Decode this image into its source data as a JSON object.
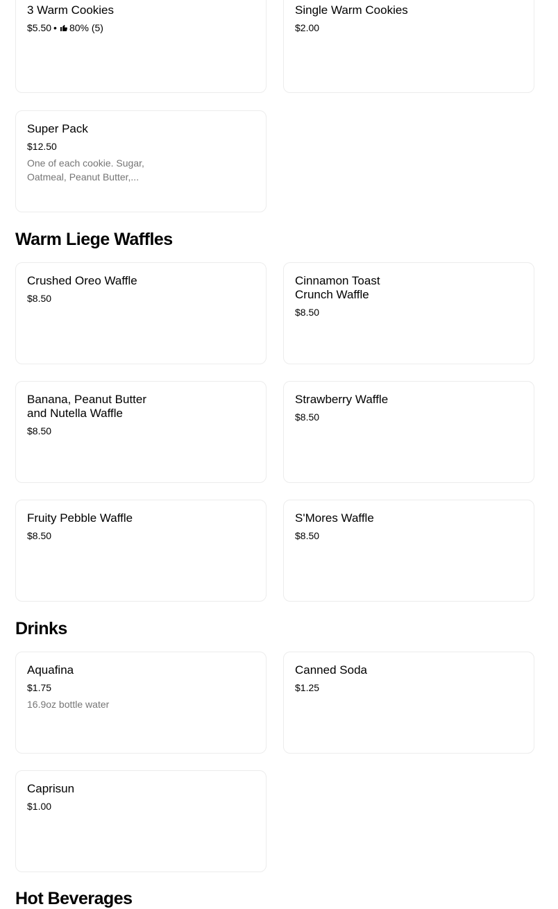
{
  "sections": [
    {
      "title": "",
      "items": [
        {
          "name": "3 Warm Cookies",
          "price": "$5.50",
          "rating": "80% (5)"
        },
        {
          "name": "Single Warm Cookies",
          "price": "$2.00"
        },
        {
          "name": "Super Pack",
          "price": "$12.50",
          "description": "One of each cookie. Sugar, Oatmeal, Peanut Butter,..."
        }
      ]
    },
    {
      "title": "Warm Liege Waffles",
      "items": [
        {
          "name": "Crushed Oreo Waffle",
          "price": "$8.50"
        },
        {
          "name": "Cinnamon Toast Crunch Waffle",
          "price": "$8.50"
        },
        {
          "name": "Banana, Peanut Butter and Nutella Waffle",
          "price": "$8.50"
        },
        {
          "name": "Strawberry Waffle",
          "price": "$8.50"
        },
        {
          "name": "Fruity Pebble Waffle",
          "price": "$8.50"
        },
        {
          "name": "S'Mores Waffle",
          "price": "$8.50"
        }
      ]
    },
    {
      "title": "Drinks",
      "items": [
        {
          "name": "Aquafina",
          "price": "$1.75",
          "description": "16.9oz bottle water"
        },
        {
          "name": "Canned Soda",
          "price": "$1.25"
        },
        {
          "name": "Caprisun",
          "price": "$1.00"
        }
      ]
    },
    {
      "title": "Hot Beverages",
      "items": []
    }
  ],
  "rating_separator": "•",
  "icons": {
    "rating": "thumbs-up-icon"
  }
}
